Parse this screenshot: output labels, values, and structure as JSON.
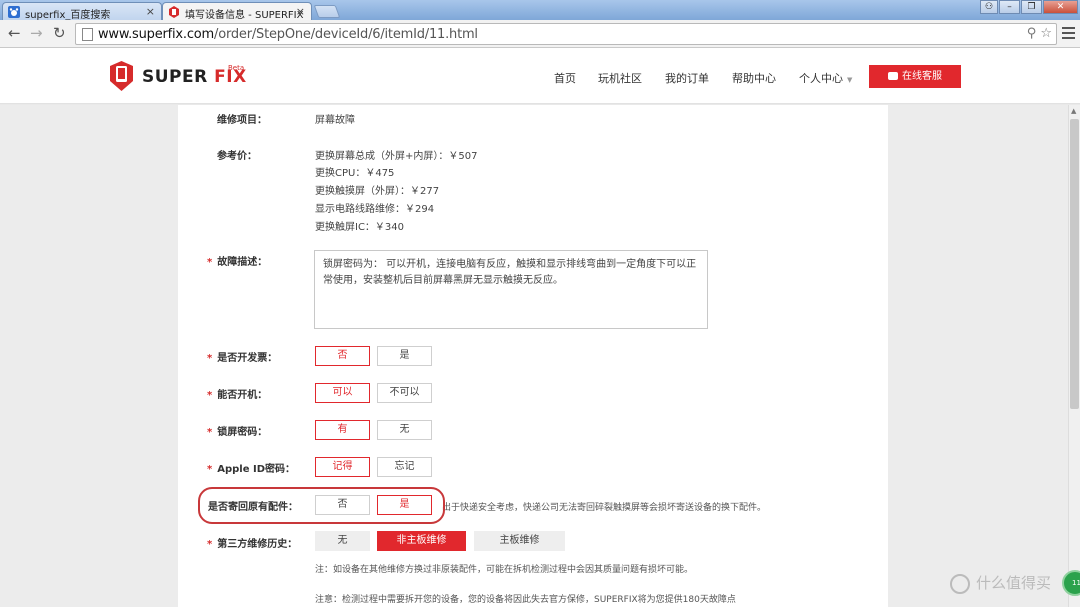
{
  "browser": {
    "tabs": [
      {
        "label": "superfix_百度搜索",
        "close": "×"
      },
      {
        "label": "填写设备信息 - SUPERFIX",
        "close": "×"
      }
    ],
    "url_host": "www.superfix.com",
    "url_path": "/order/StepOne/deviceId/6/itemId/11.html",
    "window_controls": [
      "⚇",
      "–",
      "❐",
      "✕"
    ],
    "omnibox_icons": "⚲ ☆"
  },
  "site": {
    "logo_super": "SUPER",
    "logo_fix": "FIX",
    "beta": "Beta",
    "nav": [
      "首页",
      "玩机社区",
      "我的订单",
      "帮助中心",
      "个人中心"
    ],
    "service_button": "在线客服",
    "brand_color": "#e1282d"
  },
  "form": {
    "repair_item_label": "维修项目：",
    "repair_item_value": "屏幕故障",
    "price_label": "参考价：",
    "prices": [
      "更换屏幕总成（外屏+内屏）：￥507",
      "更换CPU：￥475",
      "更换触摸屏（外屏）：￥277",
      "显示电路线路维修：￥294",
      "更换触屏IC：￥340"
    ],
    "fault_label": "故障描述：",
    "fault_text": "锁屏密码为：       可以开机，连接电脑有反应，触摸和显示排线弯曲到一定角度下可以正常使用，安装整机后目前屏幕黑屏无显示触摸无反应。",
    "invoice_label": "是否开发票：",
    "invoice_options": [
      "否",
      "是"
    ],
    "boot_label": "能否开机：",
    "boot_options": [
      "可以",
      "不可以"
    ],
    "lock_label": "锁屏密码：",
    "lock_options": [
      "有",
      "无"
    ],
    "appleid_label": "Apple ID密码：",
    "appleid_options": [
      "记得",
      "忘记"
    ],
    "return_parts_label": "是否寄回原有配件：",
    "return_parts_options": [
      "否",
      "是"
    ],
    "return_parts_hint": "出于快递安全考虑，快递公司无法寄回碎裂触摸屏等会损坏寄送设备的换下配件。",
    "history_label": "第三方维修历史：",
    "history_options": [
      "无",
      "非主板维修",
      "主板维修"
    ],
    "history_note": "注：如设备在其他维修方换过非原装配件，可能在拆机检测过程中会因其质量问题有损坏可能。",
    "bottom_note": "注意：检测过程中需要拆开您的设备，您的设备将因此失去官方保修，SUPERFIX将为您提供180天故障点",
    "required_mark": "*"
  },
  "overlay": {
    "watermark": "什么值得买",
    "badge": "11"
  }
}
